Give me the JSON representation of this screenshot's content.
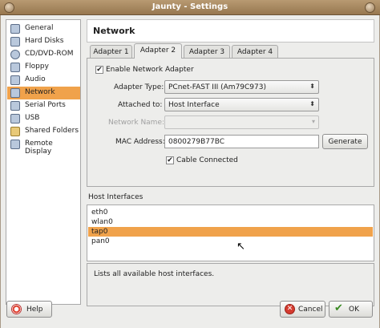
{
  "window": {
    "title": "Jaunty - Settings"
  },
  "sidebar": {
    "items": [
      {
        "label": "General",
        "icon": "general-icon"
      },
      {
        "label": "Hard Disks",
        "icon": "hard-disk-icon"
      },
      {
        "label": "CD/DVD-ROM",
        "icon": "cdrom-icon"
      },
      {
        "label": "Floppy",
        "icon": "floppy-icon"
      },
      {
        "label": "Audio",
        "icon": "audio-icon"
      },
      {
        "label": "Network",
        "icon": "network-icon",
        "selected": true
      },
      {
        "label": "Serial Ports",
        "icon": "serial-port-icon"
      },
      {
        "label": "USB",
        "icon": "usb-icon"
      },
      {
        "label": "Shared Folders",
        "icon": "shared-folder-icon"
      },
      {
        "label": "Remote Display",
        "icon": "remote-display-icon"
      }
    ]
  },
  "page": {
    "title": "Network"
  },
  "tabs": [
    {
      "label": "Adapter 1"
    },
    {
      "label": "Adapter 2",
      "active": true
    },
    {
      "label": "Adapter 3"
    },
    {
      "label": "Adapter 4"
    }
  ],
  "adapter": {
    "enable_label": "Enable Network Adapter",
    "enable_checked": true,
    "type_label": "Adapter Type:",
    "type_value": "PCnet-FAST III (Am79C973)",
    "attached_label": "Attached to:",
    "attached_value": "Host Interface",
    "network_name_label": "Network Name:",
    "network_name_value": "",
    "mac_label": "MAC Address:",
    "mac_value": "0800279B77BC",
    "generate_label": "Generate",
    "cable_label": "Cable Connected",
    "cable_checked": true
  },
  "host_interfaces": {
    "label": "Host Interfaces",
    "items": [
      "eth0",
      "wlan0",
      "tap0",
      "pan0"
    ],
    "selected": "tap0",
    "description": "Lists all available host interfaces."
  },
  "buttons": {
    "help": "Help",
    "cancel": "Cancel",
    "ok": "OK"
  },
  "colors": {
    "selection": "#f0a24b",
    "titlebar": "#a88660"
  }
}
